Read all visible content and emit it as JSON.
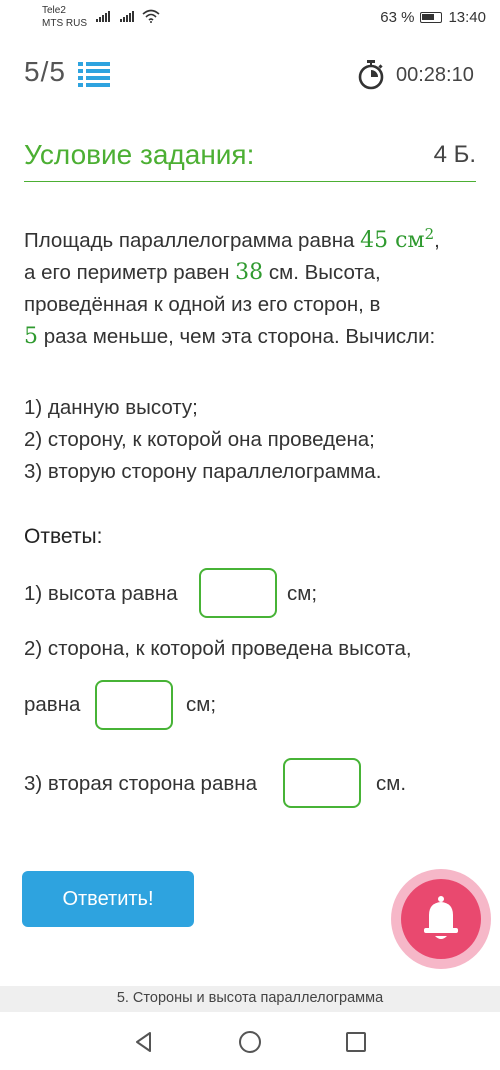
{
  "status_bar": {
    "carrier_line1": "Tele2",
    "carrier_line2": "MTS RUS",
    "battery_text": "63 %",
    "time": "13:40"
  },
  "header": {
    "progress": "5/5",
    "timer": "00:28:10",
    "icons": [
      "list-icon",
      "stopwatch-icon"
    ]
  },
  "condition": {
    "title": "Условие задания:",
    "points": "4 Б."
  },
  "problem": {
    "text1": "Площадь параллелограмма равна ",
    "area_value": "45 см",
    "area_exp": "2",
    "text2": ",",
    "text3": "а его периметр равен ",
    "perimeter_value": "38",
    "text4": " см. Высота,",
    "text5": "проведённая к одной из его сторон, в",
    "ratio_value": "5",
    "text6": " раза меньше, чем эта сторона. Вычисли:",
    "tasks": [
      "1) данную высоту;",
      "2) сторону, к которой она проведена;",
      "3) вторую сторону параллелограмма."
    ]
  },
  "answers": {
    "title": "Ответы:",
    "a1_label": "1) высота равна",
    "a1_unit": "см;",
    "a2_label_line1": "2) сторона, к которой проведена высота,",
    "a2_label_line2": "равна",
    "a2_unit": "см;",
    "a3_label": "3) вторая сторона равна",
    "a3_unit": "см.",
    "a1_value": "",
    "a2_value": "",
    "a3_value": ""
  },
  "submit_label": "Ответить!",
  "footer": "5. Стороны и высота параллелограмма",
  "colors": {
    "accent_green": "#4caf33",
    "submit_blue": "#2ea3df",
    "bell_pink": "#e9496f"
  }
}
